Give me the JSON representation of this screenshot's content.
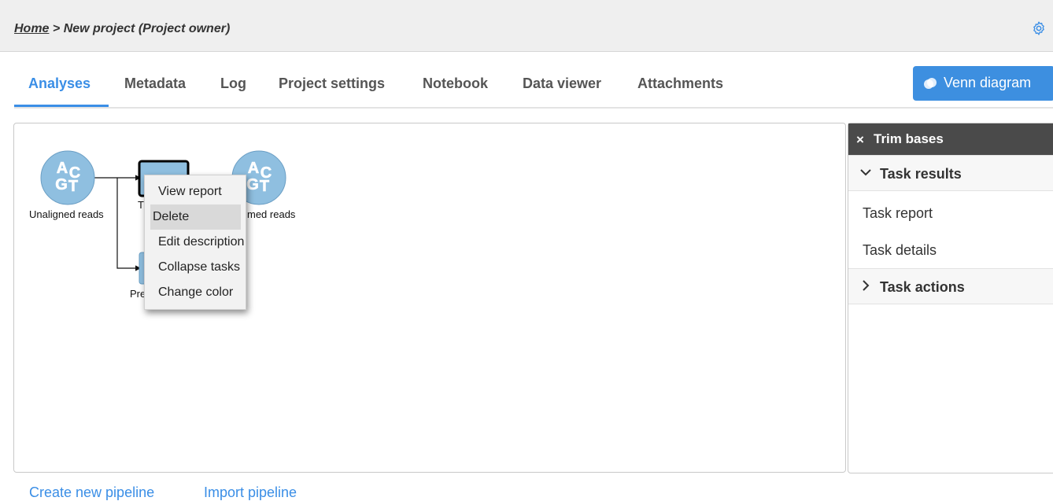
{
  "breadcrumb": {
    "home": "Home",
    "separator": " > ",
    "current": "New project (Project owner)"
  },
  "tabs": [
    {
      "label": "Analyses",
      "active": true
    },
    {
      "label": "Metadata"
    },
    {
      "label": "Log"
    },
    {
      "label": "Project settings"
    },
    {
      "label": "Notebook"
    },
    {
      "label": "Data viewer"
    },
    {
      "label": "Attachments"
    }
  ],
  "venn_button": {
    "label": "Venn diagram",
    "icon": "venn-icon"
  },
  "pipeline": {
    "nodes": [
      {
        "label": "Unaligned reads",
        "kind": "data",
        "icon": "acgt-icon"
      },
      {
        "label": "Tr",
        "kind": "task",
        "icon": "task-icon",
        "selected": true
      },
      {
        "label": "med reads",
        "kind": "data",
        "icon": "acgt-icon"
      },
      {
        "label": "Pre",
        "kind": "task",
        "icon": "task-icon"
      }
    ],
    "context_menu": [
      {
        "label": "View report"
      },
      {
        "label": "Delete",
        "hover": true
      },
      {
        "label": "Edit description"
      },
      {
        "label": "Collapse tasks"
      },
      {
        "label": "Change color"
      }
    ]
  },
  "side_panel": {
    "close_glyph": "×",
    "title": "Trim bases",
    "sections": [
      {
        "label": "Task results",
        "expanded": true,
        "items": [
          "Task report",
          "Task details"
        ]
      },
      {
        "label": "Task actions",
        "expanded": false
      }
    ]
  },
  "bottom_links": [
    "Create new pipeline",
    "Import pipeline"
  ],
  "colors": {
    "accent": "#3a8ee6",
    "node_fill": "#8fbfe0",
    "panel_header": "#4a4a4a"
  }
}
